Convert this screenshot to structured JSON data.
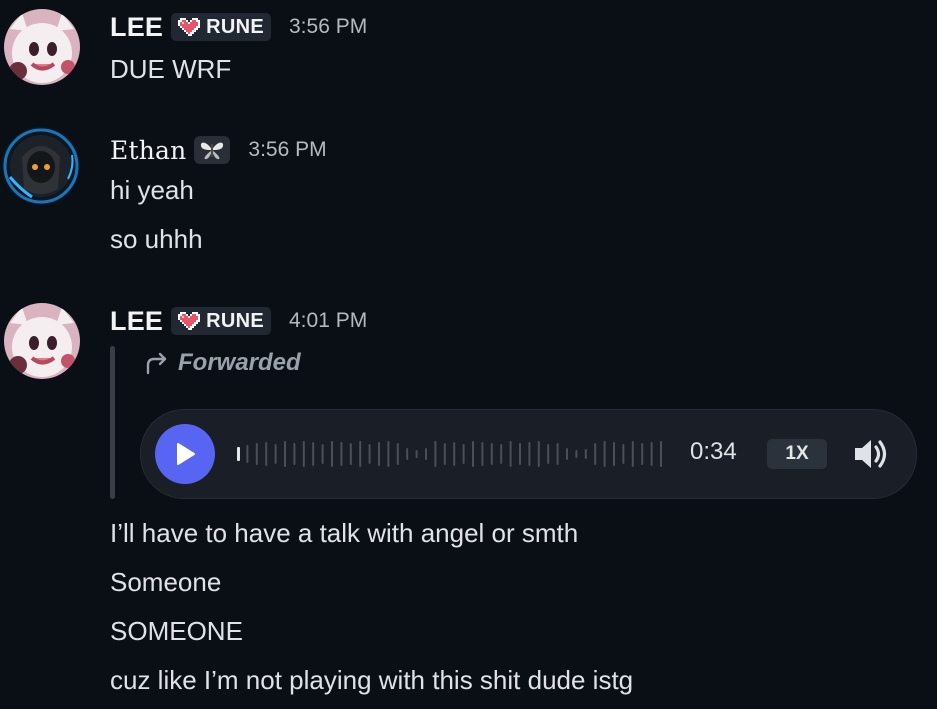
{
  "messages": [
    {
      "author": "LEE",
      "tag": "RUNE",
      "time": "3:56 PM",
      "lines": [
        "DUE WRF"
      ]
    },
    {
      "author": "Ethan",
      "time": "3:56 PM",
      "lines": [
        "hi yeah",
        "so uhhh"
      ]
    },
    {
      "author": "LEE",
      "tag": "RUNE",
      "time": "4:01 PM",
      "forwarded_label": "Forwarded",
      "voice": {
        "duration": "0:34",
        "speed": "1X",
        "progress": 0.0
      },
      "lines": [
        "I’ll have to have a talk with angel or smth",
        "Someone",
        "SOMEONE",
        "cuz like I’m not playing with this shit dude istg"
      ]
    }
  ],
  "icons": {
    "tag": "pixel-heart-icon",
    "ethan_badge": "butterfly-icon",
    "forward": "forward-arrow-icon",
    "play": "play-icon",
    "volume": "speaker-icon"
  },
  "colors": {
    "background": "#0a0f16",
    "accent": "#5865f2",
    "tag_bg": "#222832",
    "heart": "#e8546a"
  }
}
